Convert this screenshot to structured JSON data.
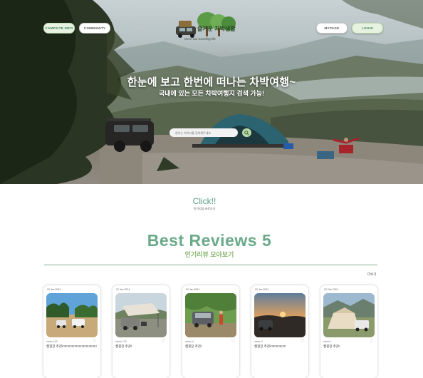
{
  "hero": {
    "nav_left": [
      "CAMPSITE INFO",
      "COMMUNITY"
    ],
    "nav_right": [
      "MYPAGE",
      "LOGIN"
    ],
    "logo_text": "즐거운 차박생활",
    "logo_tagline": "Go in our traveling life",
    "headline": "한눈에 보고 한번에 떠나는 차박여행~",
    "subheadline": "국내에 있는 모든 차박여행지 검색 가능!",
    "search_placeholder": "원하는 차박지를 검색해주세요",
    "search_icon": "search-icon"
  },
  "click_section": {
    "title": "Click!!",
    "subtitle": "인기리뷰 바로가기"
  },
  "best": {
    "title": "Best Reviews 5",
    "subtitle": "인기리뷰 모아보기",
    "more": "더보기"
  },
  "reviews": [
    {
      "date": "03 Jan 2024",
      "views": "views 163",
      "title": "캠핑장 추천!!!!!!!!!!!!!!!!!!!!!!!!!!!!!!!!!!!!!!!",
      "image": "beach camping with cars"
    },
    {
      "date": "02 Jan 2024",
      "views": "views 133",
      "title": "캠핑장 추천!",
      "image": "awning tent beside car"
    },
    {
      "date": "02 Jan 2024",
      "views": "views 4",
      "title": "캠핑장 추천!",
      "image": "car camping in forest"
    },
    {
      "date": "03 Jan 2024",
      "views": "views 3",
      "title": "캠핑장 추천!!!!!!!!!!!!!!!!!!",
      "image": "sunset with car"
    },
    {
      "date": "02 Feb 2024",
      "views": "views 1",
      "title": "캠핑장 추천!",
      "image": "rooftop tent near lake"
    }
  ]
}
